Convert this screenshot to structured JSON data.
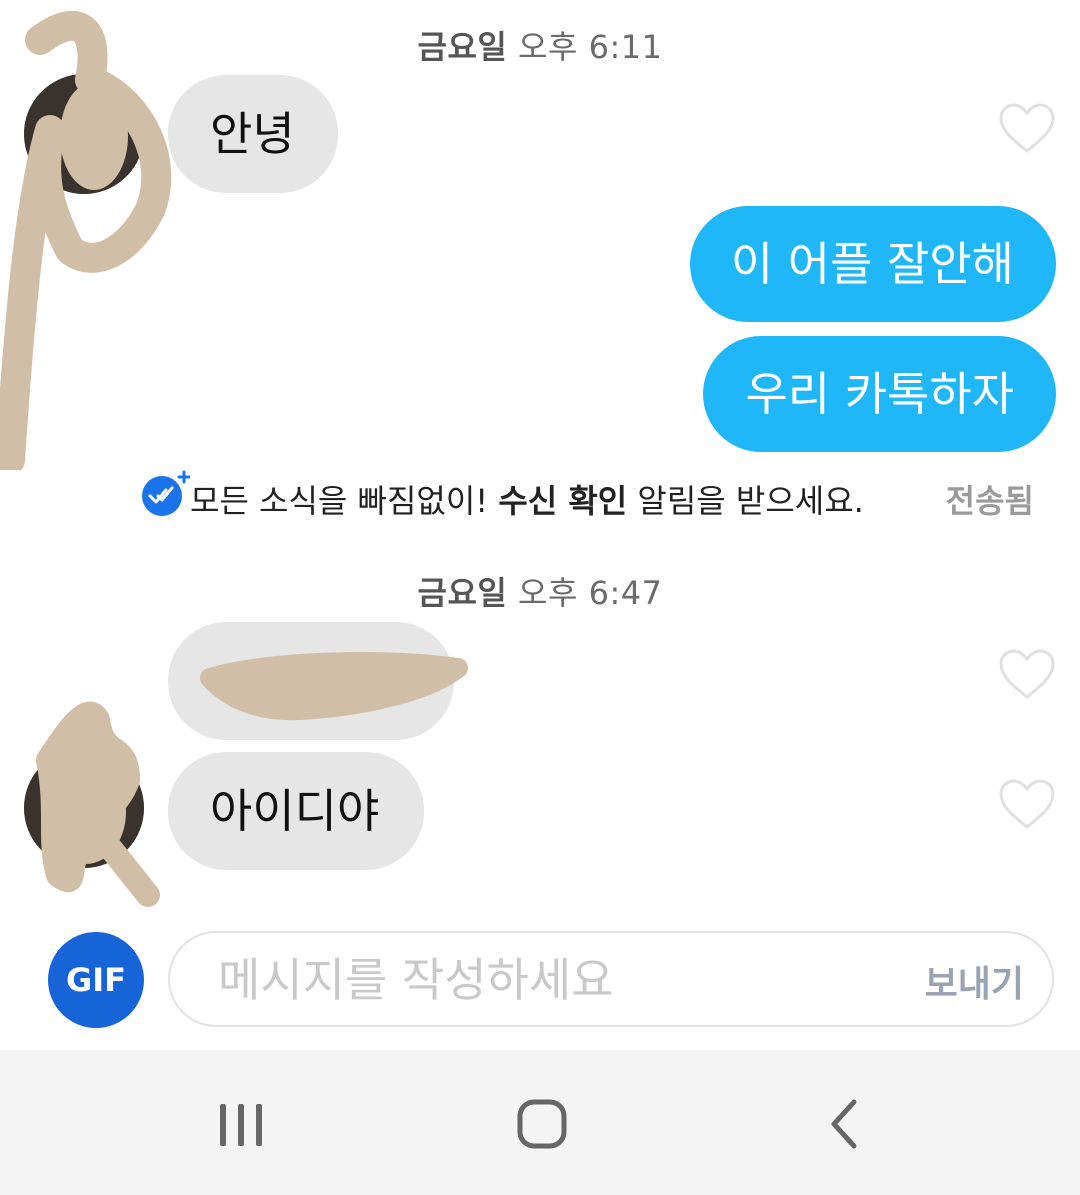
{
  "chat": {
    "sections": [
      {
        "date": {
          "day": "금요일",
          "time": "오후 6:11"
        },
        "messages": [
          {
            "text": "안녕"
          },
          {
            "text": "이 어플 잘안해"
          },
          {
            "text": "우리 카톡하자"
          }
        ]
      },
      {
        "date": {
          "day": "금요일",
          "time": "오후 6:47"
        },
        "messages": [
          {
            "text": ""
          },
          {
            "text": "아이디야"
          }
        ]
      }
    ],
    "receipt_notice": {
      "pre": "모든 소식을 빠짐없이! ",
      "bold": "수신 확인",
      "post": " 알림을 받으세요.",
      "status": "전송됨"
    }
  },
  "composer": {
    "gif_label": "GIF",
    "placeholder": "메시지를 작성하세요",
    "send_label": "보내기"
  },
  "nav": {
    "recents": "recent-apps-icon",
    "home": "home-icon",
    "back": "back-icon"
  },
  "colors": {
    "outgoing_bubble": "#1fb7f8",
    "incoming_bubble": "#e6e6e6",
    "gif_button": "#1664d8",
    "receipt_badge": "#1a73e8"
  }
}
